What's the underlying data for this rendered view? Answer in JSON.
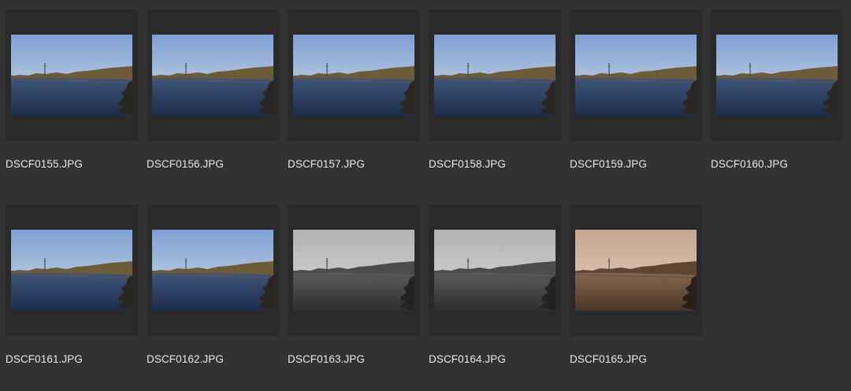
{
  "photos": [
    {
      "name": "DSCF0155.JPG",
      "tone": "color"
    },
    {
      "name": "DSCF0156.JPG",
      "tone": "color"
    },
    {
      "name": "DSCF0157.JPG",
      "tone": "color"
    },
    {
      "name": "DSCF0158.JPG",
      "tone": "color"
    },
    {
      "name": "DSCF0159.JPG",
      "tone": "color"
    },
    {
      "name": "DSCF0160.JPG",
      "tone": "color"
    },
    {
      "name": "DSCF0161.JPG",
      "tone": "color"
    },
    {
      "name": "DSCF0162.JPG",
      "tone": "color"
    },
    {
      "name": "DSCF0163.JPG",
      "tone": "monochrome"
    },
    {
      "name": "DSCF0164.JPG",
      "tone": "monochrome"
    },
    {
      "name": "DSCF0165.JPG",
      "tone": "sepia"
    }
  ],
  "palettes": {
    "color": {
      "sky_top": "#7f9fd6",
      "sky_bottom": "#aac0dc",
      "bank": "#6e5b3a",
      "water_top": "#41577d",
      "water_bottom": "#1d2d4d",
      "rocks": "#2a2723"
    },
    "monochrome": {
      "sky_top": "#b4b4b4",
      "sky_bottom": "#c6c6c6",
      "bank": "#4c4c4c",
      "water_top": "#5d5d5d",
      "water_bottom": "#2f2f2f",
      "rocks": "#222222"
    },
    "sepia": {
      "sky_top": "#c4a692",
      "sky_bottom": "#d6bca8",
      "bank": "#5d4634",
      "water_top": "#8a6a54",
      "water_bottom": "#4b3526",
      "rocks": "#2a2019"
    }
  }
}
